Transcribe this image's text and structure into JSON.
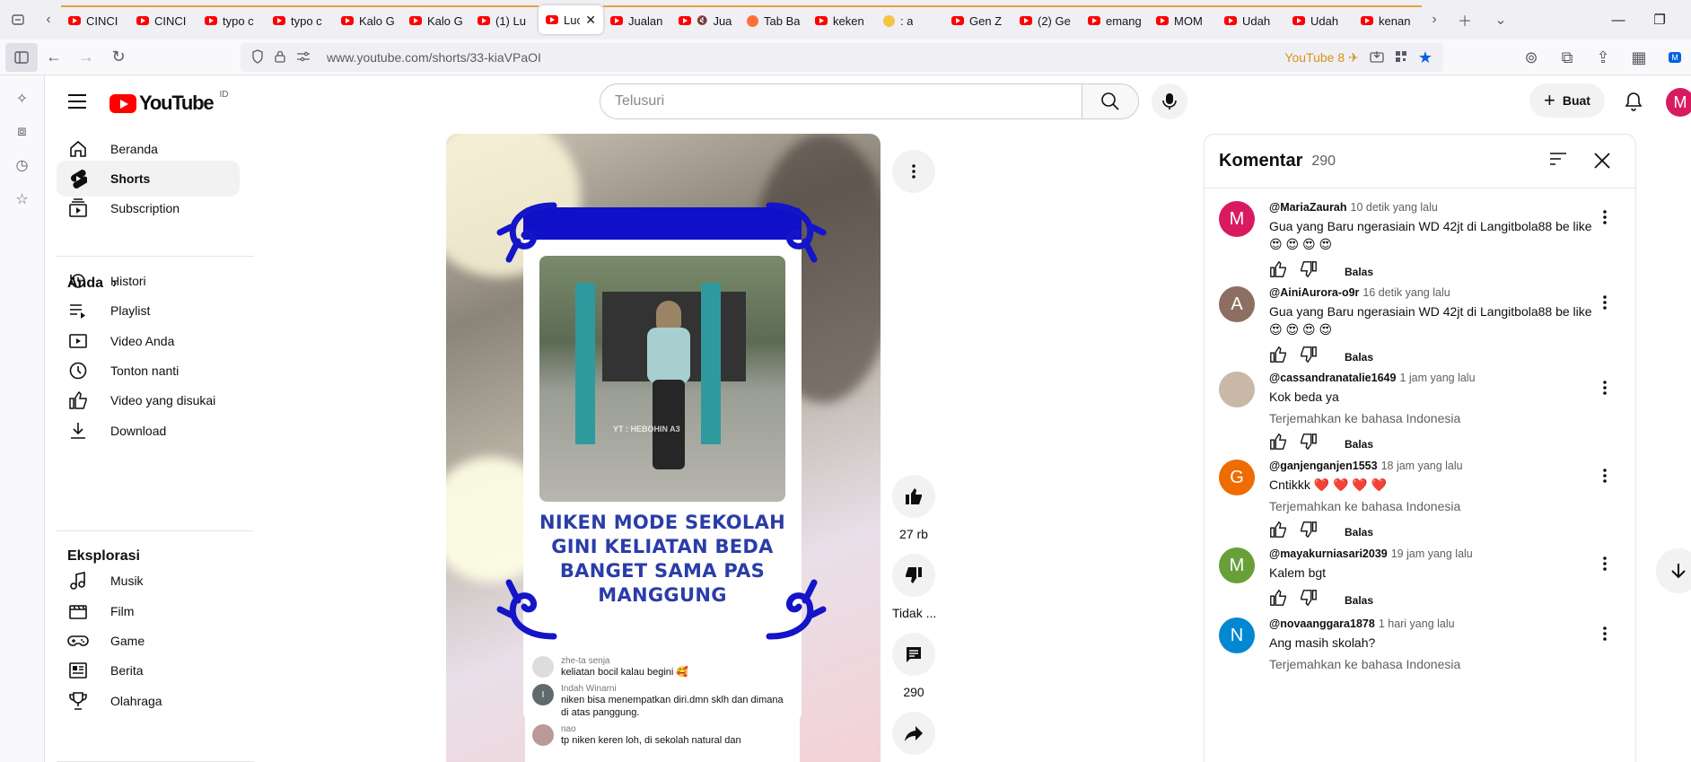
{
  "browser": {
    "tabs": [
      {
        "label": "CINCI",
        "icon": "youtube"
      },
      {
        "label": "CINCI",
        "icon": "youtube"
      },
      {
        "label": "typo c",
        "icon": "youtube"
      },
      {
        "label": "typo c",
        "icon": "youtube"
      },
      {
        "label": "Kalo G",
        "icon": "youtube"
      },
      {
        "label": "Kalo G",
        "icon": "youtube"
      },
      {
        "label": "(1) Lu",
        "icon": "youtube"
      },
      {
        "label": "Luc",
        "icon": "youtube",
        "active": true
      },
      {
        "label": "Jualan",
        "icon": "youtube"
      },
      {
        "label": "Jualan",
        "icon": "youtube-muted"
      },
      {
        "label": "Tab Ba",
        "icon": "firefox"
      },
      {
        "label": "keken",
        "icon": "youtube"
      },
      {
        "label": ": a",
        "icon": "emoji"
      },
      {
        "label": "Gen Z",
        "icon": "youtube"
      },
      {
        "label": "(2) Ge",
        "icon": "youtube"
      },
      {
        "label": "emang",
        "icon": "youtube"
      },
      {
        "label": "MOM",
        "icon": "youtube"
      },
      {
        "label": "Udah",
        "icon": "youtube"
      },
      {
        "label": "Udah",
        "icon": "youtube"
      },
      {
        "label": "kenan",
        "icon": "youtube"
      }
    ],
    "url": "www.youtube.com/shorts/33-kiaVPaOI",
    "extension_badge": "YouTube 8",
    "profile_badge": "M",
    "accent_color": "#0061e0"
  },
  "masthead": {
    "logo_text": "YouTube",
    "country_code": "ID",
    "search_placeholder": "Telusuri",
    "create_label": "Buat",
    "avatar_letter": "M"
  },
  "sidebar": {
    "main": [
      {
        "label": "Beranda",
        "icon": "home-icon"
      },
      {
        "label": "Shorts",
        "icon": "shorts-icon",
        "active": true
      },
      {
        "label": "Subscription",
        "icon": "subscriptions-icon"
      }
    ],
    "you_heading": "Anda",
    "you": [
      {
        "label": "Histori",
        "icon": "history-icon"
      },
      {
        "label": "Playlist",
        "icon": "playlist-icon"
      },
      {
        "label": "Video Anda",
        "icon": "your-videos-icon"
      },
      {
        "label": "Tonton nanti",
        "icon": "watch-later-icon"
      },
      {
        "label": "Video yang disukai",
        "icon": "liked-icon"
      },
      {
        "label": "Download",
        "icon": "download-icon"
      }
    ],
    "explore_heading": "Eksplorasi",
    "explore": [
      {
        "label": "Musik",
        "icon": "music-icon"
      },
      {
        "label": "Film",
        "icon": "film-icon"
      },
      {
        "label": "Game",
        "icon": "gaming-icon"
      },
      {
        "label": "Berita",
        "icon": "news-icon"
      },
      {
        "label": "Olahraga",
        "icon": "trophy-icon"
      }
    ]
  },
  "short": {
    "caption_lines": [
      "NIKEN MODE SEKOLAH",
      "GINI KELIATAN BEDA",
      "BANGET SAMA PAS",
      "MANGGUNG"
    ],
    "watermark": "YT : HEBOHIN A3",
    "overlay_comments": [
      {
        "name": "zhe-ta senja",
        "text": "keliatan bocil kalau begini 🥰"
      },
      {
        "name": "Indah Winarni",
        "initial": "I",
        "text": "niken bisa menempatkan diri.dmn sklh dan dimana di atas panggung."
      },
      {
        "name": "nao",
        "text": "tp niken keren loh, di sekolah natural dan"
      }
    ],
    "likes": "27 rb",
    "dislike_label": "Tidak ...",
    "comments_count": "290"
  },
  "comments_panel": {
    "title": "Komentar",
    "count": "290",
    "translate_label": "Terjemahkan ke bahasa Indonesia",
    "reply_label": "Balas",
    "items": [
      {
        "handle": "@MariaZaurah",
        "time": "10 detik yang lalu",
        "initial": "M",
        "color": "#d81b60",
        "text": "Gua yang Baru ngerasiain WD 42jt di Langitbola88 be like😍 😍 😍 😍",
        "translate": false
      },
      {
        "handle": "@AiniAurora-o9r",
        "time": "16 detik yang lalu",
        "initial": "A",
        "color": "#8d6e63",
        "text": "Gua yang Baru ngerasiain WD 42jt di Langitbola88 be like😍 😍 😍 😍",
        "translate": false
      },
      {
        "handle": "@cassandranatalie1649",
        "time": "1 jam yang lalu",
        "initial": "",
        "color": "#c9b8a8",
        "text": "Kok beda ya",
        "translate": true
      },
      {
        "handle": "@ganjenganjen1553",
        "time": "18 jam yang lalu",
        "initial": "G",
        "color": "#ef6c00",
        "text": "Cntikkk ❤️ ❤️ ❤️ ❤️",
        "translate": true
      },
      {
        "handle": "@mayakurniasari2039",
        "time": "19 jam yang lalu",
        "initial": "M",
        "color": "#689f38",
        "text": "Kalem bgt",
        "translate": false
      },
      {
        "handle": "@novaanggara1878",
        "time": "1 hari yang lalu",
        "initial": "N",
        "color": "#0288d1",
        "text": "Ang masih skolah?",
        "translate": true
      }
    ]
  }
}
